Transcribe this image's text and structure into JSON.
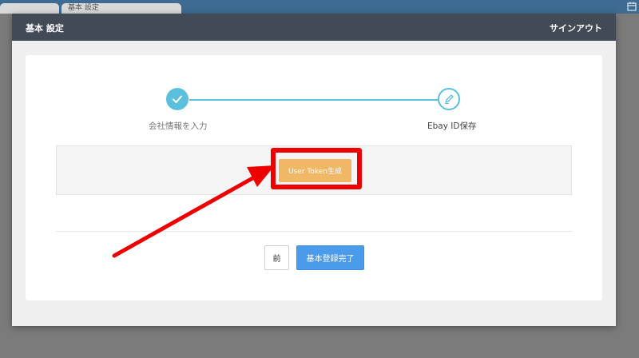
{
  "browser": {
    "tabs": [
      {
        "label": ""
      },
      {
        "label": "基本 設定"
      }
    ]
  },
  "modal": {
    "title": "基本 設定",
    "signout_label": "サインアウト"
  },
  "stepper": {
    "steps": [
      {
        "label": "会社情報を入力",
        "status": "complete",
        "icon": "check-icon"
      },
      {
        "label": "Ebay ID保存",
        "status": "current",
        "icon": "pencil-icon"
      }
    ],
    "accent_color": "#5bc0de"
  },
  "token": {
    "button_label": "User Token生成",
    "button_color": "#f0ad4e",
    "highlight_color": "#ee0000"
  },
  "footer": {
    "prev_label": "前",
    "complete_label": "基本登録完了",
    "complete_color": "#4a9bea"
  }
}
